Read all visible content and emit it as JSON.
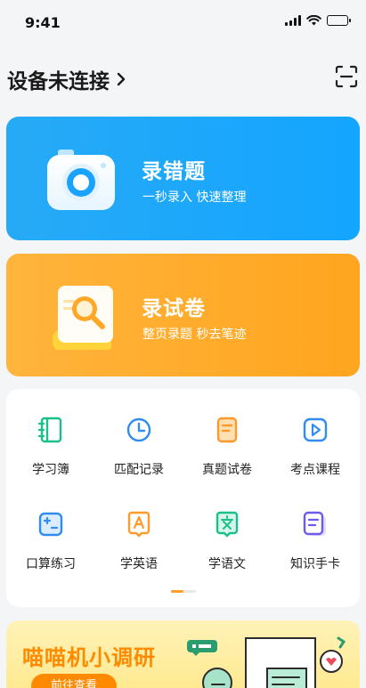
{
  "status_bar": {
    "time": "9:41"
  },
  "header": {
    "device_status": "设备未连接",
    "chevron": "chevron-right-icon",
    "scan_icon": "scan-icon"
  },
  "cards": [
    {
      "title": "录错题",
      "subtitle": "一秒录入 快速整理",
      "icon": "camera-icon",
      "color": "#1aa7fb"
    },
    {
      "title": "录试卷",
      "subtitle": "整页录题 秒去笔迹",
      "icon": "document-search-icon",
      "color": "#ffab2b"
    }
  ],
  "grid": {
    "items": [
      {
        "label": "学习簿",
        "icon": "notebook-icon",
        "color": "#19c08a"
      },
      {
        "label": "匹配记录",
        "icon": "clock-icon",
        "color": "#2f8df0"
      },
      {
        "label": "真题试卷",
        "icon": "paper-icon",
        "color": "#ff9a2a"
      },
      {
        "label": "考点课程",
        "icon": "play-icon",
        "color": "#2f8df0"
      },
      {
        "label": "口算练习",
        "icon": "calculator-icon",
        "color": "#2f8df0"
      },
      {
        "label": "学英语",
        "icon": "english-icon",
        "color": "#ff9a2a"
      },
      {
        "label": "学语文",
        "icon": "chinese-icon",
        "color": "#19c08a"
      },
      {
        "label": "知识手卡",
        "icon": "flashcard-icon",
        "color": "#6b5cf0"
      }
    ],
    "page_indicator": {
      "current": 1,
      "total": 2
    }
  },
  "banner": {
    "title": "喵喵机小调研",
    "cta": "前往查看"
  }
}
